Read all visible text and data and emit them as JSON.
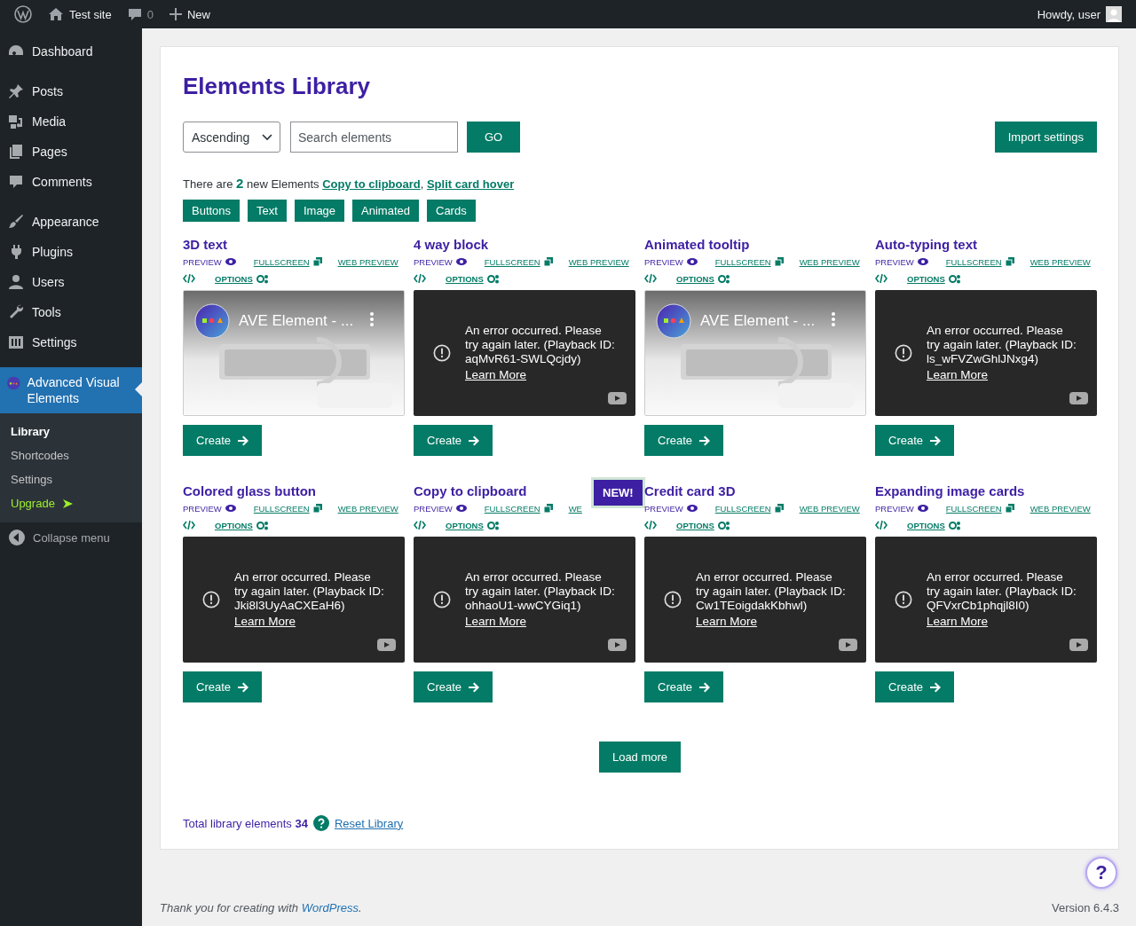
{
  "admin_bar": {
    "site": "Test site",
    "comments": "0",
    "new": "New",
    "greeting": "Howdy, user"
  },
  "sidebar": {
    "items": [
      {
        "label": "Dashboard",
        "selected": false
      },
      {
        "label": "Posts",
        "selected": false,
        "gap": true
      },
      {
        "label": "Media",
        "selected": false
      },
      {
        "label": "Pages",
        "selected": false
      },
      {
        "label": "Comments",
        "selected": false
      },
      {
        "label": "Appearance",
        "selected": false,
        "gap": true
      },
      {
        "label": "Plugins",
        "selected": false
      },
      {
        "label": "Users",
        "selected": false
      },
      {
        "label": "Tools",
        "selected": false
      },
      {
        "label": "Settings",
        "selected": false
      },
      {
        "label": "Advanced Visual Elements",
        "selected": true,
        "gap": true,
        "children": [
          {
            "label": "Library",
            "kind": "sub",
            "selected": true
          },
          {
            "label": "Shortcodes",
            "kind": "sub",
            "selected": false
          },
          {
            "label": "Settings",
            "kind": "sub",
            "selected": false
          },
          {
            "label": "Upgrade",
            "kind": "upgrade",
            "selected": false
          }
        ]
      }
    ],
    "collapse": "Collapse menu"
  },
  "page": {
    "title": "Elements Library",
    "sort": "Ascending",
    "search": {
      "placeholder": "Search elements"
    },
    "go": "GO",
    "import": "Import settings",
    "notice": {
      "text": "There are **2** new Elements",
      "links": [
        "Copy to clipboard",
        "Split card hover"
      ],
      "separator": ", "
    },
    "filters": [
      "Buttons",
      "Text",
      "Image",
      "Animated",
      "Cards"
    ],
    "cards": [
      {
        "title": "3D text",
        "preview": "PREVIEW",
        "fullscreen": "FULLSCREEN",
        "web_preview": "WEB PREVIEW",
        "options": "OPTIONS",
        "video": {
          "kind": "video",
          "title": "AVE Element - ..."
        },
        "create": "Create"
      },
      {
        "title": "4 way block",
        "preview": "PREVIEW",
        "fullscreen": "FULLSCREEN",
        "web_preview": "WEB PREVIEW",
        "options": "OPTIONS",
        "video": {
          "kind": "error",
          "message": "An error occurred. Please try again later. (Playback ID: aqMvR61-SWLQcjdy)",
          "link": "Learn More"
        },
        "create": "Create"
      },
      {
        "title": "Animated tooltip",
        "preview": "PREVIEW",
        "fullscreen": "FULLSCREEN",
        "web_preview": "WEB PREVIEW",
        "options": "OPTIONS",
        "video": {
          "kind": "video",
          "title": "AVE Element - ..."
        },
        "create": "Create"
      },
      {
        "title": "Auto-typing text",
        "preview": "PREVIEW",
        "fullscreen": "FULLSCREEN",
        "web_preview": "WEB PREVIEW",
        "options": "OPTIONS",
        "video": {
          "kind": "error",
          "message": "An error occurred. Please try again later. (Playback ID: ls_wFVZwGhlJNxg4)",
          "link": "Learn More"
        },
        "create": "Create"
      },
      {
        "title": "Colored glass button",
        "preview": "PREVIEW",
        "fullscreen": "FULLSCREEN",
        "web_preview": "WEB PREVIEW",
        "options": "OPTIONS",
        "video": {
          "kind": "error",
          "message": "An error occurred. Please try again later. (Playback ID: Jki8l3UyAaCXEaH6)",
          "link": "Learn More"
        },
        "create": "Create"
      },
      {
        "title": "Copy to clipboard",
        "preview": "PREVIEW",
        "fullscreen": "FULLSCREEN",
        "web_preview": "WE",
        "options": "OPTIONS",
        "badge": "NEW!",
        "video": {
          "kind": "error",
          "message": "An error occurred. Please try again later. (Playback ID: ohhaoU1-wwCYGiq1)",
          "link": "Learn More"
        },
        "create": "Create"
      },
      {
        "title": "Credit card 3D",
        "preview": "PREVIEW",
        "fullscreen": "FULLSCREEN",
        "web_preview": "WEB PREVIEW",
        "options": "OPTIONS",
        "video": {
          "kind": "error",
          "message": "An error occurred. Please try again later. (Playback ID: Cw1TEoigdakKbhwl)",
          "link": "Learn More"
        },
        "create": "Create"
      },
      {
        "title": "Expanding image cards",
        "preview": "PREVIEW",
        "fullscreen": "FULLSCREEN",
        "web_preview": "WEB PREVIEW",
        "options": "OPTIONS",
        "video": {
          "kind": "error",
          "message": "An error occurred. Please try again later. (Playback ID: QFVxrCb1phqjl8I0)",
          "link": "Learn More"
        },
        "create": "Create"
      }
    ],
    "load_more": "Load more",
    "total": "Total library elements **34**",
    "reset": "Reset Library"
  },
  "footer": {
    "text": "Thank you for creating with",
    "link": "WordPress",
    "end": ".",
    "version": "Version 6.4.3",
    "help": "?"
  }
}
